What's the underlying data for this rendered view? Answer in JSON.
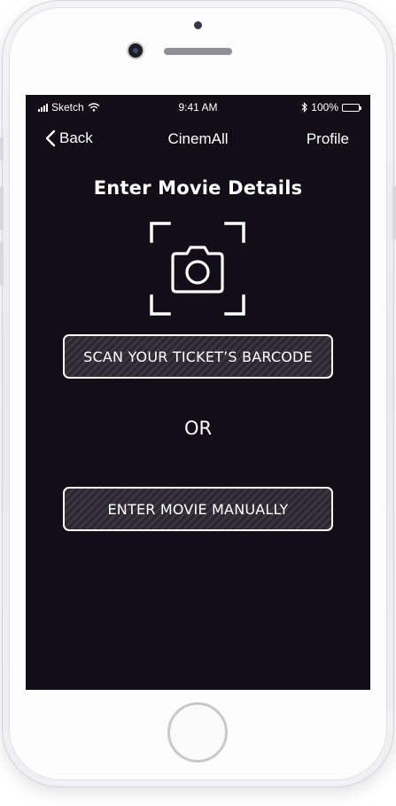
{
  "status_bar": {
    "carrier": "Sketch",
    "time": "9:41 AM",
    "battery": "100%"
  },
  "nav": {
    "back_label": "Back",
    "title": "CinemAll",
    "profile_label": "Profile"
  },
  "main": {
    "heading": "Enter Movie Details",
    "scan_button_label": "SCAN YOUR TICKET’S BARCODE",
    "or_label": "OR",
    "manual_button_label": "ENTER MOVIE MANUALLY"
  },
  "colors": {
    "screen_background": "#120e18",
    "text": "#ffffff",
    "button_border": "#ffffff"
  },
  "icons": [
    "signal-icon",
    "wifi-icon",
    "bluetooth-icon",
    "battery-icon",
    "back-chevron-icon",
    "camera-scan-icon"
  ]
}
